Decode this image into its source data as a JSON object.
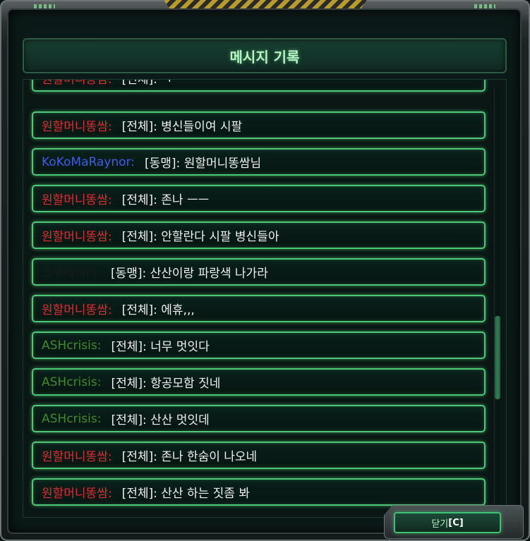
{
  "window": {
    "title": "메시지 기록"
  },
  "messages": [
    {
      "sender": "원할머니똥쌈:",
      "channel": "[전체]:",
      "text": "ㅋ",
      "color": "#d93030",
      "partial": true
    },
    {
      "sender": "원할머니똥쌈:",
      "channel": "[전체]:",
      "text": "병신들이여 시팔",
      "color": "#d93030"
    },
    {
      "sender": "KoKoMaRaynor:",
      "channel": "[동맹]:",
      "text": "원할머니똥쌈님",
      "color": "#3a5ee8"
    },
    {
      "sender": "원할머니똥쌈:",
      "channel": "[전체]:",
      "text": "존나 ㅡㅡ",
      "color": "#d93030"
    },
    {
      "sender": "원할머니똥쌈:",
      "channel": "[전체]:",
      "text": "안할란다 시팔  병신들아",
      "color": "#d93030"
    },
    {
      "sender": "크루세이더:",
      "channel": "[동맹]:",
      "text": "산산이랑 파랑색 나가라",
      "color": "#1a1a1a"
    },
    {
      "sender": "원할머니똥쌈:",
      "channel": "[전체]:",
      "text": "에휴,,,",
      "color": "#d93030"
    },
    {
      "sender": "ASHcrisis:",
      "channel": "[전체]:",
      "text": "너무 멋잇다",
      "color": "#3e8a2e"
    },
    {
      "sender": "ASHcrisis:",
      "channel": "[전체]:",
      "text": "항공모함 짓네",
      "color": "#3e8a2e"
    },
    {
      "sender": "ASHcrisis:",
      "channel": "[전체]:",
      "text": "산산 멋잇데",
      "color": "#3e8a2e"
    },
    {
      "sender": "원할머니똥쌈:",
      "channel": "[전체]:",
      "text": "존나 한숨이 나오네",
      "color": "#d93030"
    },
    {
      "sender": "원할머니똥쌈:",
      "channel": "[전체]:",
      "text": "산산 하는 짓좀 봐",
      "color": "#d93030"
    }
  ],
  "close_button": {
    "label": "닫기",
    "hotkey": "C"
  },
  "colors": {
    "accent": "#4ec878",
    "title_text": "#b8f5c4",
    "enemy_red": "#d93030",
    "ally_blue": "#3a5ee8",
    "observer_green": "#3e8a2e"
  }
}
